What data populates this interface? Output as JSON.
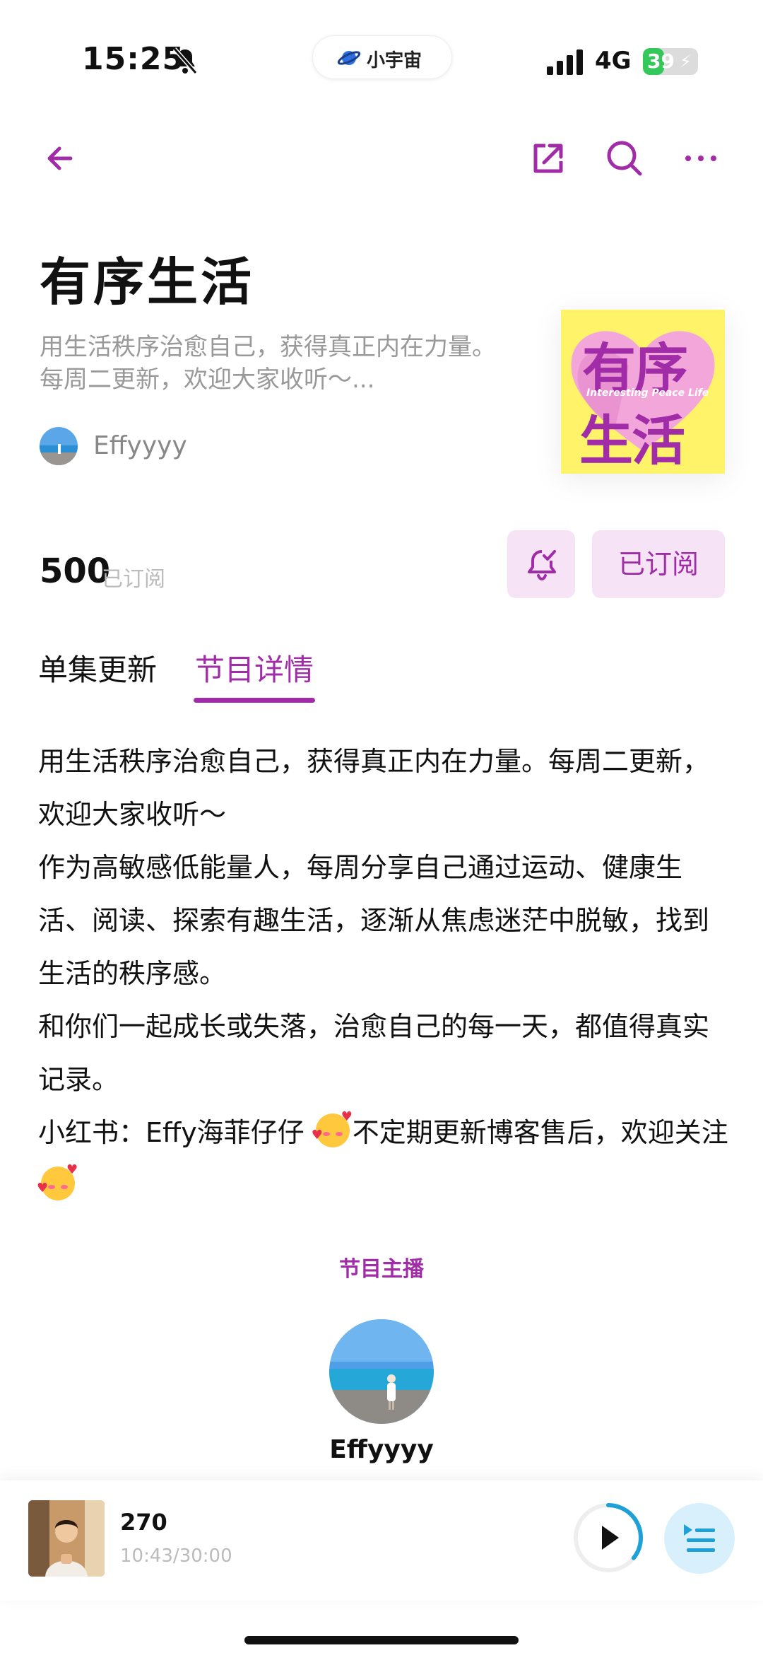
{
  "status_bar": {
    "time": "15:25",
    "island_text": "小宇宙",
    "network": "4G",
    "battery": "39",
    "battery_level_percent": 39
  },
  "podcast": {
    "title": "有序生活",
    "subtitle": "用生活秩序治愈自己，获得真正内在力量。每周二更新，欢迎大家收听～...",
    "cover_line1": "有序",
    "cover_tagline": "Interesting Peace Life",
    "cover_line2": "生活",
    "host_name": "Effyyyy",
    "subscriber_count": "500",
    "subscriber_label": "已订阅",
    "subscribed_button": "已订阅"
  },
  "tabs": {
    "episodes": "单集更新",
    "details": "节目详情"
  },
  "description": {
    "p1": "用生活秩序治愈自己，获得真正内在力量。每周二更新，欢迎大家收听～",
    "p2": "作为高敏感低能量人，每周分享自己通过运动、健康生活、阅读、探索有趣生活，逐渐从焦虑迷茫中脱敏，找到生活的秩序感。",
    "p3": "和你们一起成长或失落，治愈自己的每一天，都值得真实记录。",
    "p4_a": "小红书：Effy海菲仔仔 ",
    "p4_b": "不定期更新博客售后，欢迎关注"
  },
  "host_section": {
    "title": "节目主播",
    "name": "Effyyyy"
  },
  "player": {
    "episode_title": "270",
    "time": "10:43/30:00",
    "progress_fraction": 0.357
  },
  "colors": {
    "accent": "#a12ca8",
    "accent_light": "#f6e3f6",
    "cover_bg": "#fff36a",
    "battery_green": "#34c759",
    "player_blue": "#1ea0d8"
  }
}
